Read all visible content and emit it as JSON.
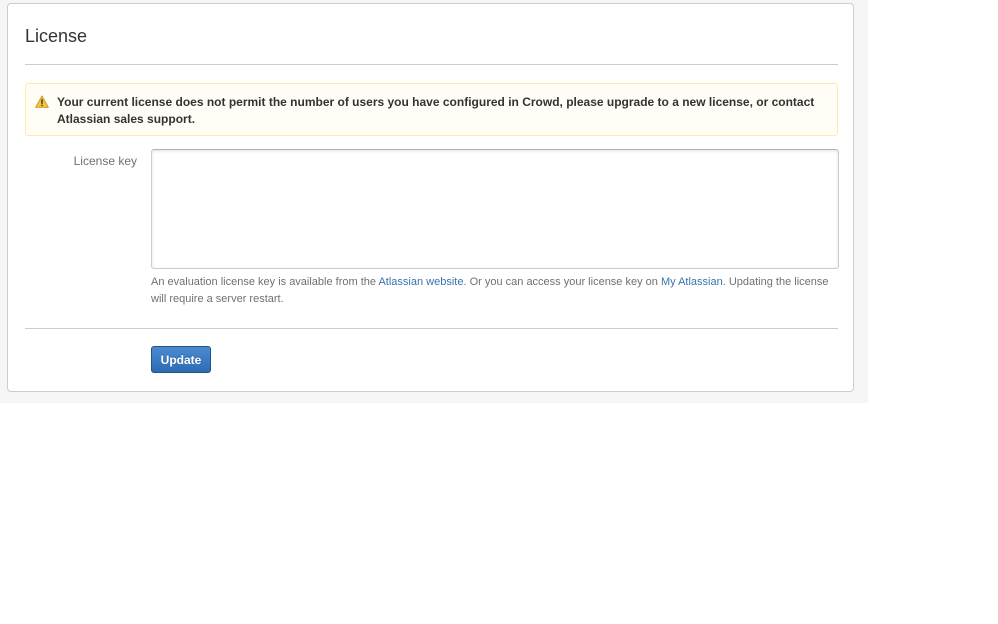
{
  "page": {
    "title": "License"
  },
  "warning": {
    "icon": "warning-triangle-icon",
    "message": "Your current license does not permit the number of users you have configured in Crowd, please upgrade to a new license, or contact Atlassian sales support."
  },
  "form": {
    "license_key_label": "License key",
    "license_key_value": "",
    "help": {
      "prefix": "An evaluation license key is available from the ",
      "atlassian_website_link": "Atlassian website",
      "middle": ".  Or you can access your license key on ",
      "my_atlassian_link": "My Atlassian",
      "suffix": ". Updating the license will require a server restart."
    },
    "update_label": "Update"
  },
  "colors": {
    "link": "#3b73af",
    "button": "#3572b0",
    "warning_background": "#fffdf6",
    "warning_border": "#ffeaae",
    "warning_icon": "#f6c342"
  }
}
